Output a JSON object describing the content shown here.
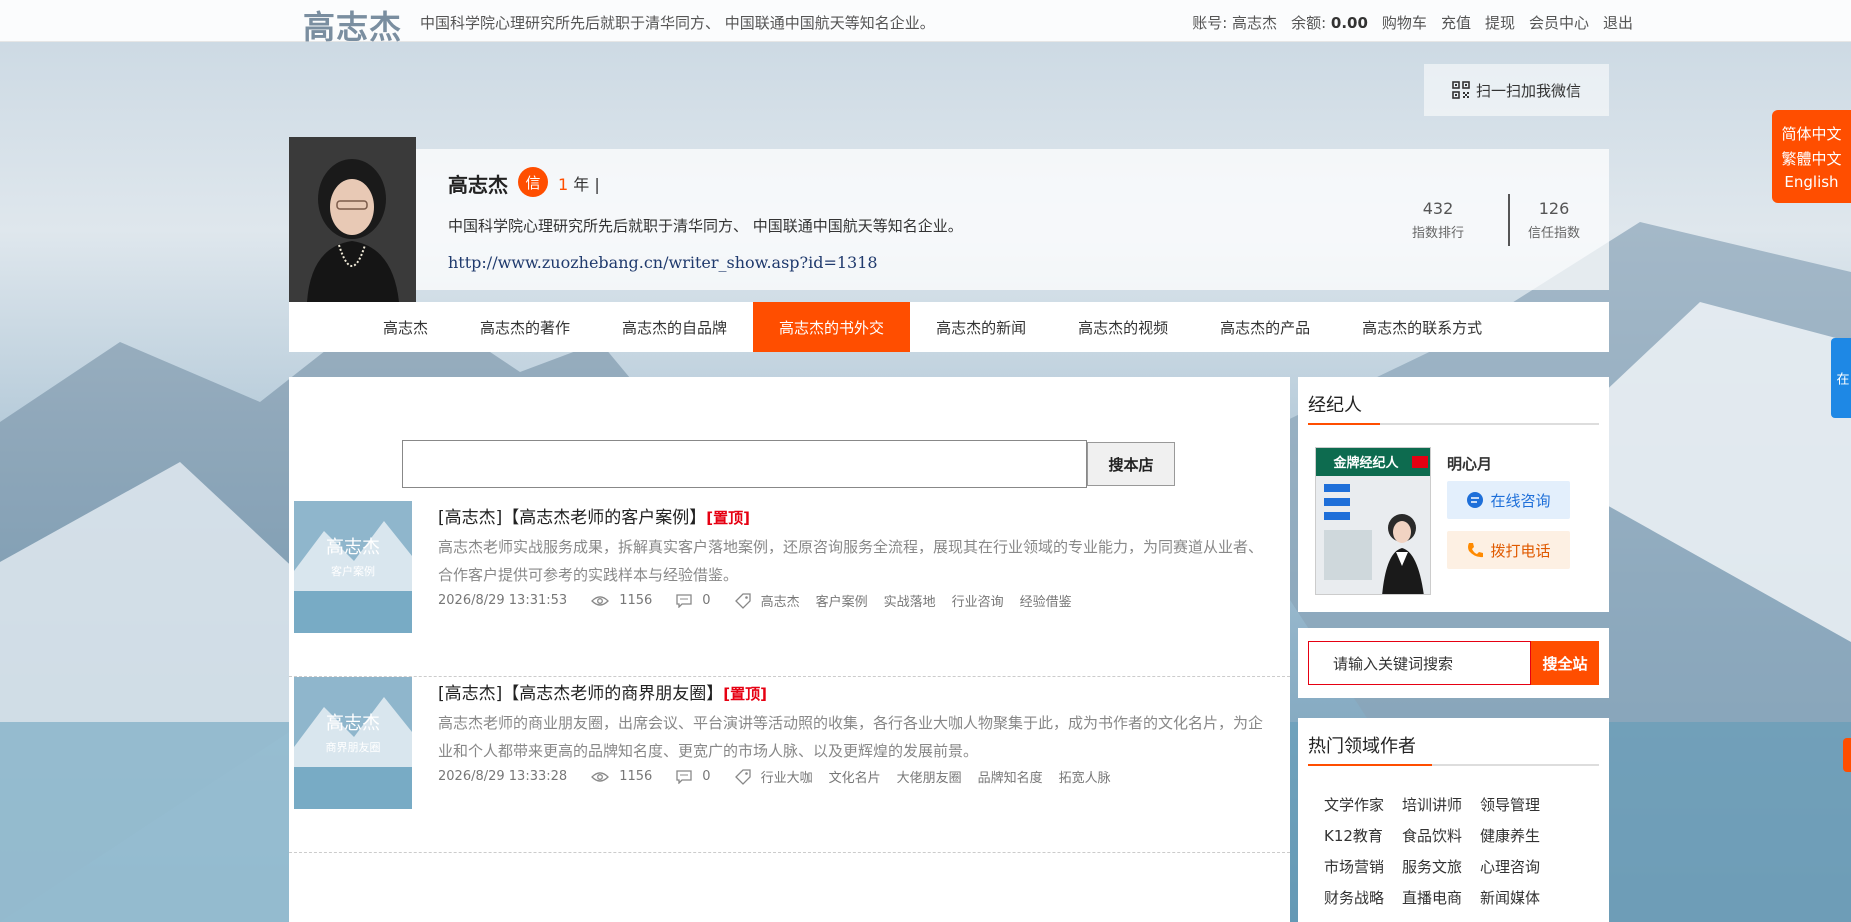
{
  "topbar": {
    "logo": "高志杰",
    "desc": "中国科学院心理研究所先后就职于清华同方、 中国联通中国航天等知名企业。",
    "account_label": "账号: 高志杰",
    "balance_label": "余额:",
    "balance_value": "0.00",
    "links": [
      "购物车",
      "充值",
      "提现",
      "会员中心",
      "退出"
    ]
  },
  "wechat": {
    "label": "扫一扫加我微信"
  },
  "lang": {
    "items": [
      "简体中文",
      "繁體中文",
      "English"
    ]
  },
  "side_tab": {
    "label": "在"
  },
  "profile": {
    "name": "高志杰",
    "badge": "信",
    "years_num": "1",
    "years_unit": "年 |",
    "desc": "中国科学院心理研究所先后就职于清华同方、 中国联通中国航天等知名企业。",
    "url": "http://www.zuozhebang.cn/writer_show.asp?id=1318",
    "stats": [
      {
        "num": "432",
        "label": "指数排行"
      },
      {
        "num": "126",
        "label": "信任指数"
      }
    ]
  },
  "nav": {
    "items": [
      "高志杰",
      "高志杰的著作",
      "高志杰的自品牌",
      "高志杰的书外交",
      "高志杰的新闻",
      "高志杰的视频",
      "高志杰的产品",
      "高志杰的联系方式"
    ],
    "active": 3
  },
  "store_search": {
    "button": "搜本店"
  },
  "articles": [
    {
      "title": "[高志杰]【高志杰老师的客户案例】",
      "top_label": "[置顶]",
      "summary": "高志杰老师实战服务成果，拆解真实客户落地案例，还原咨询服务全流程，展现其在行业领域的专业能力，为同赛道从业者、合作客户提供可参考的实践样本与经验借鉴。",
      "date": "2026/8/29 13:31:53",
      "views": "1156",
      "comments": "0",
      "tags": [
        "高志杰",
        "客户案例",
        "实战落地",
        "行业咨询",
        "经验借鉴"
      ],
      "thumb_title": "高志杰",
      "thumb_sub": "客户案例"
    },
    {
      "title": "[高志杰]【高志杰老师的商界朋友圈】",
      "top_label": "[置顶]",
      "summary": "高志杰老师的商业朋友圈，出席会议、平台演讲等活动照的收集，各行各业大咖人物聚集于此，成为书作者的文化名片，为企业和个人都带来更高的品牌知名度、更宽广的市场人脉、以及更辉煌的发展前景。",
      "date": "2026/8/29 13:33:28",
      "views": "1156",
      "comments": "0",
      "tags": [
        "行业大咖",
        "文化名片",
        "大佬朋友圈",
        "品牌知名度",
        "拓宽人脉"
      ],
      "thumb_title": "高志杰",
      "thumb_sub": "商界朋友圈"
    }
  ],
  "agent": {
    "title": "经纪人",
    "name": "明心月",
    "consult": "在线咨询",
    "call": "拨打电话",
    "poster_title": "金牌经纪人"
  },
  "site_search": {
    "placeholder": "请输入关键词搜索",
    "button": "搜全站"
  },
  "hot": {
    "title": "热门领域作者",
    "items": [
      "文学作家",
      "培训讲师",
      "领导管理",
      "K12教育",
      "食品饮料",
      "健康养生",
      "市场营销",
      "服务文旅",
      "心理咨询",
      "财务战略",
      "直播电商",
      "新闻媒体"
    ]
  },
  "colors": {
    "accent": "#ff4e00",
    "link": "#1f3a6d",
    "top_red": "#e60012"
  }
}
